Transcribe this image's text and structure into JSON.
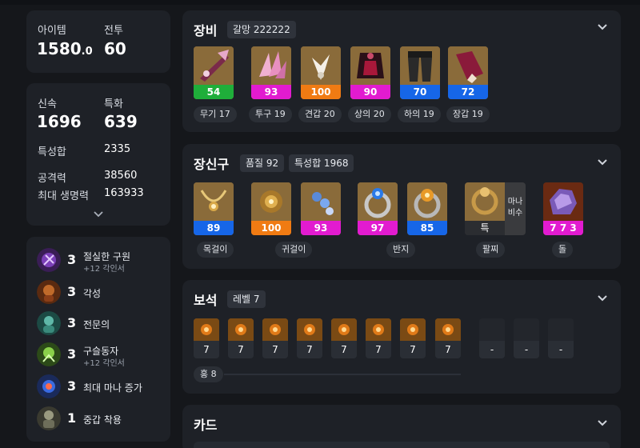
{
  "summary": {
    "item_level_label": "아이템",
    "item_level_value": "1580",
    "item_level_decimal": ".0",
    "combat_label": "전투",
    "combat_value": "60"
  },
  "stats": {
    "swiftness_label": "신속",
    "swiftness_value": "1696",
    "specialization_label": "특화",
    "specialization_value": "639",
    "total_label": "특성합",
    "total_value": "2335",
    "attack_label": "공격력",
    "attack_value": "38560",
    "hp_label": "최대 생명력",
    "hp_value": "163933"
  },
  "engravings": [
    {
      "level": "3",
      "name": "절실한 구원",
      "sub": "+12 각인서",
      "icon": "grudge-purple-icon"
    },
    {
      "level": "3",
      "name": "각성",
      "sub": "",
      "icon": "awakening-icon"
    },
    {
      "level": "3",
      "name": "전문의",
      "sub": "",
      "icon": "specialist-icon"
    },
    {
      "level": "3",
      "name": "구슬동자",
      "sub": "+12 각인서",
      "icon": "orb-child-icon"
    },
    {
      "level": "3",
      "name": "최대 마나 증가",
      "sub": "",
      "icon": "max-mana-icon"
    },
    {
      "level": "1",
      "name": "중갑 착용",
      "sub": "",
      "icon": "heavy-armor-icon"
    }
  ],
  "equipment": {
    "title": "장비",
    "badge": "갈망 222222",
    "items": [
      {
        "quality": "54",
        "label": "무기 17",
        "color": "#1fae3a"
      },
      {
        "quality": "93",
        "label": "투구 19",
        "color": "#e21bd0"
      },
      {
        "quality": "100",
        "label": "견갑 20",
        "color": "#f07b13"
      },
      {
        "quality": "90",
        "label": "상의 20",
        "color": "#e21bd0"
      },
      {
        "quality": "70",
        "label": "하의 19",
        "color": "#1666e8"
      },
      {
        "quality": "72",
        "label": "장갑 19",
        "color": "#1666e8"
      }
    ]
  },
  "accessories": {
    "title": "장신구",
    "badge_quality": "품질 92",
    "badge_total": "특성합 1968",
    "items": [
      {
        "quality": "89",
        "color": "#1666e8"
      },
      {
        "quality": "100",
        "color": "#f07b13"
      },
      {
        "quality": "93",
        "color": "#e21bd0"
      },
      {
        "quality": "97",
        "color": "#e21bd0"
      },
      {
        "quality": "85",
        "color": "#1666e8"
      }
    ],
    "bracelet_label": "특",
    "bracelet_side": "마나\n비수",
    "stone_value": "7 7 3",
    "labels": {
      "necklace": "목걸이",
      "earring": "귀걸이",
      "ring": "반지",
      "bracelet": "팔찌",
      "stone": "돌"
    }
  },
  "gems": {
    "title": "보석",
    "badge": "레벨 7",
    "filled": [
      "7",
      "7",
      "7",
      "7",
      "7",
      "7",
      "7",
      "7"
    ],
    "empty": [
      "-",
      "-",
      "-"
    ],
    "tag": "홍 8"
  },
  "cards": {
    "title": "카드"
  }
}
